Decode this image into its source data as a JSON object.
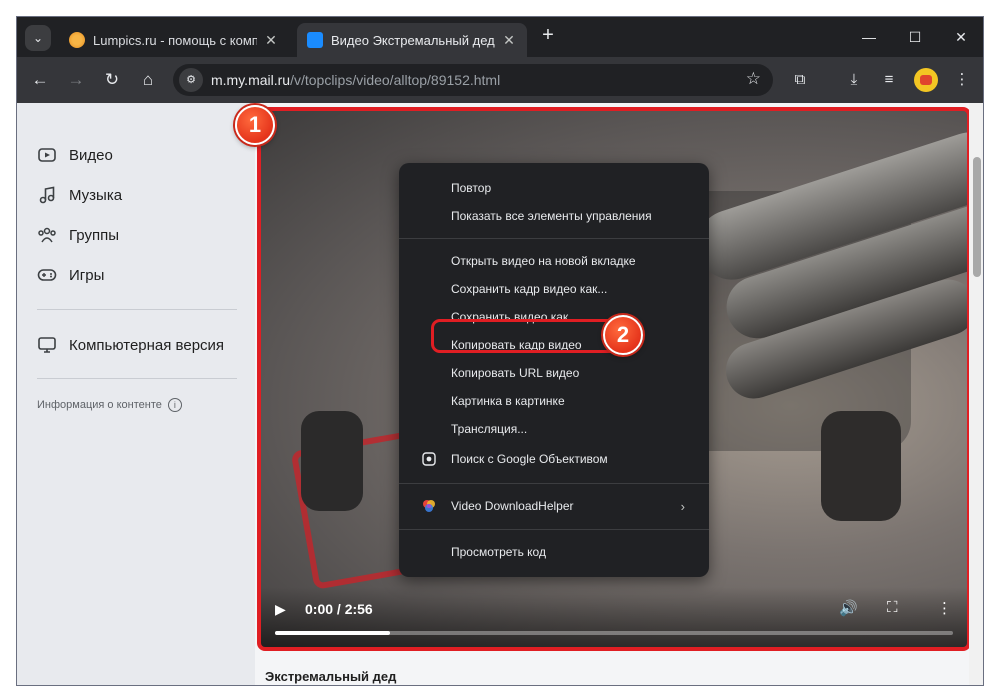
{
  "browser": {
    "tabs": [
      {
        "title": "Lumpics.ru - помощь с компь",
        "close": "✕",
        "active": false
      },
      {
        "title": "Видео Экстремальный дед, —",
        "close": "✕",
        "active": true
      }
    ],
    "new_tab": "+",
    "tab_search": "⌄",
    "window_controls": {
      "minimize": "—",
      "maximize": "☐",
      "close": "✕"
    },
    "nav": {
      "back": "←",
      "forward": "→",
      "reload": "↻",
      "home": "⌂"
    },
    "address": {
      "host": "m.my.mail.ru",
      "path": "/v/topclips/video/alltop/89152.html",
      "site_info": "⚙",
      "bookmark": "☆"
    },
    "toolbar_icons": {
      "extensions": "⧉",
      "downloads": "⤓",
      "media": "≡",
      "menu": "⋮"
    }
  },
  "sidebar": {
    "items": [
      {
        "label": "Видео",
        "icon": "video-icon"
      },
      {
        "label": "Музыка",
        "icon": "music-icon"
      },
      {
        "label": "Группы",
        "icon": "groups-icon"
      },
      {
        "label": "Игры",
        "icon": "gamepad-icon"
      }
    ],
    "desktop_version": {
      "label": "Компьютерная версия",
      "icon": "monitor-icon"
    },
    "content_info": "Информация о контенте",
    "info_glyph": "i"
  },
  "video": {
    "time": "0:00 / 2:56",
    "progress": 0.17,
    "caption": "Экстремальный дед",
    "icons": {
      "play": "▶",
      "volume": "🔊",
      "fullscreen": "⛶",
      "more": "⋮"
    }
  },
  "context_menu": {
    "groups": [
      [
        "Повтор",
        "Показать все элементы управления"
      ],
      [
        "Открыть видео на новой вкладке",
        "Сохранить кадр видео как...",
        "Сохранить видео как...",
        "Копировать кадр видео",
        "Копировать URL видео",
        "Картинка в картинке",
        "Трансляция...",
        "Поиск с Google Объективом"
      ],
      [
        "Video DownloadHelper"
      ],
      [
        "Просмотреть код"
      ]
    ],
    "submenu_arrow": "›"
  },
  "annotations": {
    "badge1": "1",
    "badge2": "2"
  },
  "colors": {
    "highlight": "#e01e23",
    "badge": "#e5341b",
    "menu_bg": "#202124",
    "tabbar": "#202124"
  }
}
